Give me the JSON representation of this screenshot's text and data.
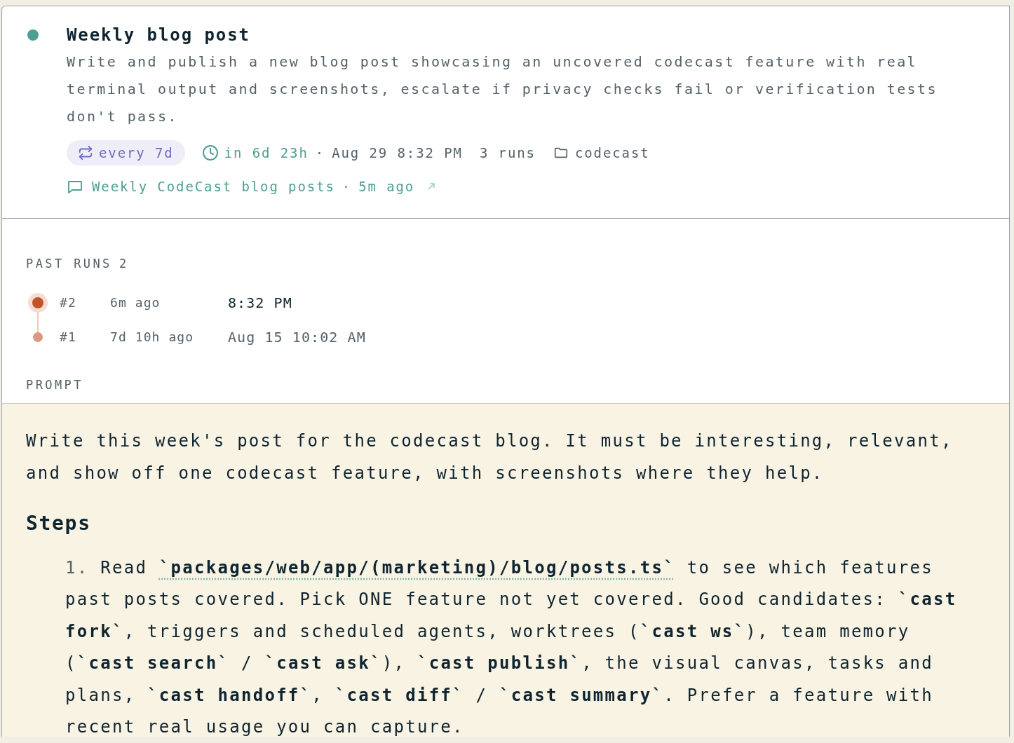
{
  "task": {
    "active": true,
    "title": "Weekly blog post",
    "description": "Write and publish a new blog post showcasing an uncovered codecast feature with real terminal output and screenshots, escalate if privacy checks fail or verification tests don't pass.",
    "schedule": "every 7d",
    "next_run": "in 6d 23h",
    "next_run_separator": "·",
    "next_run_date": "Aug 29 8:32 PM",
    "runs_count": "3 runs",
    "folder": "codecast",
    "thread": "Weekly CodeCast blog posts",
    "thread_separator": "·",
    "thread_time": "5m ago"
  },
  "past_runs": {
    "label": "PAST RUNS",
    "count": "2",
    "runs": [
      {
        "number": "#2",
        "ago": "6m ago",
        "time": "8:32 PM",
        "latest": true
      },
      {
        "number": "#1",
        "ago": "7d 10h ago",
        "time": "Aug 15 10:02 AM",
        "latest": false
      }
    ]
  },
  "prompt": {
    "label": "PROMPT",
    "intro": "Write this week's post for the codecast blog. It must be interesting, relevant, and show off one codecast feature, with screenshots where they help.",
    "heading": "Steps",
    "steps": [
      {
        "number": "1.",
        "before": "Read ",
        "path": "`packages/web/app/(marketing)/blog/posts.ts`",
        "after": " to see which features past posts covered. Pick ONE feature not yet covered. Good candidates: **`cast fork`**, triggers and scheduled agents, worktrees (**`cast ws`**), team memory (**`cast search`** / **`cast ask`**), **`cast publish`**, the visual canvas, tasks and plans, **`cast handoff`**, **`cast diff`** / **`cast summary`**. Prefer a feature with recent real usage you can capture."
      }
    ]
  }
}
